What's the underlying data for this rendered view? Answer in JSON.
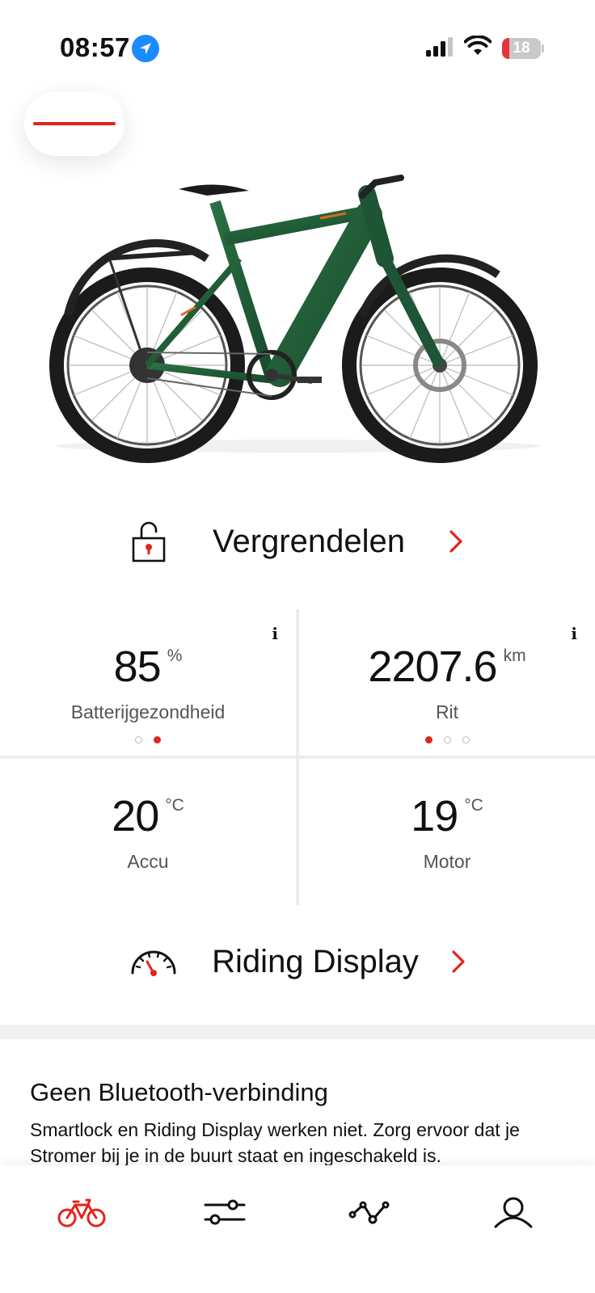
{
  "status_bar": {
    "time": "08:57",
    "battery_level": "18",
    "battery_fraction": 0.18
  },
  "lock_action": {
    "label": "Vergrendelen",
    "icon": "unlocked-padlock-icon"
  },
  "stats": [
    {
      "value": "85",
      "unit": "%",
      "caption": "Batterijgezondheid",
      "info": "i",
      "dots": [
        false,
        true
      ]
    },
    {
      "value": "2207.6",
      "unit": "km",
      "caption": "Rit",
      "info": "i",
      "dots": [
        true,
        false,
        false
      ]
    },
    {
      "value": "20",
      "unit": "°C",
      "caption": "Accu"
    },
    {
      "value": "19",
      "unit": "°C",
      "caption": "Motor"
    }
  ],
  "riding_display": {
    "label": "Riding Display",
    "icon": "speedometer-icon"
  },
  "notice": {
    "title": "Geen Bluetooth-verbinding",
    "body": "Smartlock en Riding Display werken niet. Zorg ervoor dat je Stromer bij je in de buurt staat en ingeschakeld is."
  },
  "tabs": [
    {
      "icon": "bike-icon",
      "active": true
    },
    {
      "icon": "settings-sliders-icon",
      "active": false
    },
    {
      "icon": "route-icon",
      "active": false
    },
    {
      "icon": "profile-icon",
      "active": false
    }
  ],
  "colors": {
    "accent": "#e3241b",
    "bike_green": "#1f5a36",
    "location_badge": "#1a8cff"
  }
}
